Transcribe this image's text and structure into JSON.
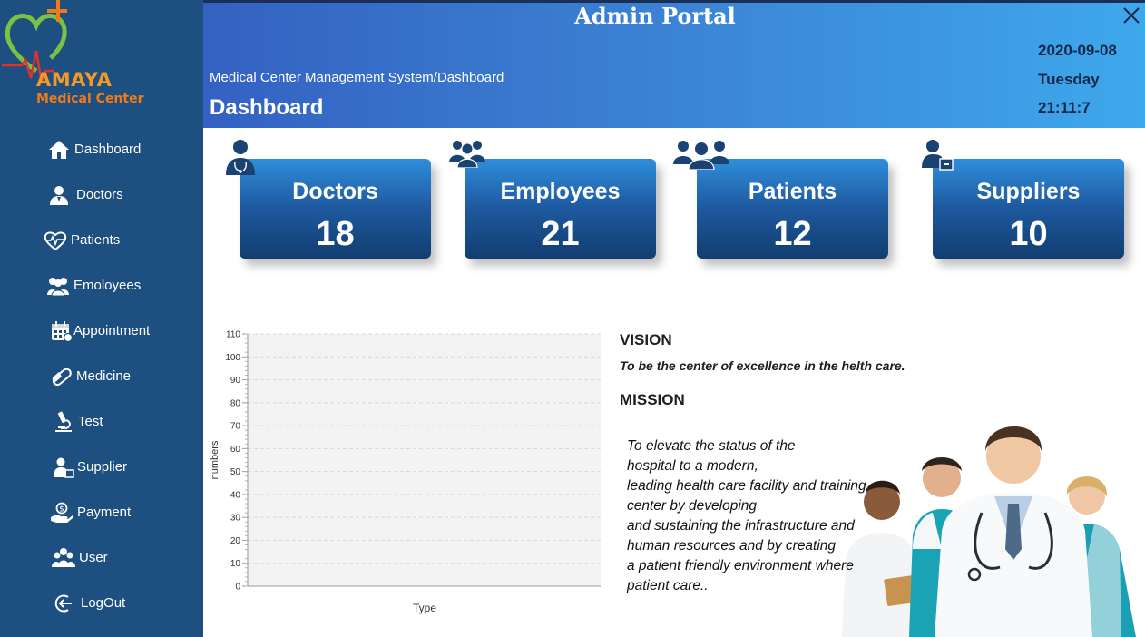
{
  "logo": {
    "name": "AMAYA",
    "subtitle": "Medical Center"
  },
  "sidebar": {
    "items": [
      {
        "label": "Dashboard",
        "icon": "home-icon"
      },
      {
        "label": "Doctors",
        "icon": "doctor-icon"
      },
      {
        "label": "Patients",
        "icon": "heart-pulse-icon"
      },
      {
        "label": "Emoloyees",
        "icon": "group-icon"
      },
      {
        "label": "Appointment",
        "icon": "calendar-icon"
      },
      {
        "label": "Medicine",
        "icon": "pill-icon"
      },
      {
        "label": "Test",
        "icon": "microscope-icon"
      },
      {
        "label": "Supplier",
        "icon": "supplier-icon"
      },
      {
        "label": "Payment",
        "icon": "payment-icon"
      },
      {
        "label": "User",
        "icon": "users-icon"
      },
      {
        "label": "LogOut",
        "icon": "logout-icon"
      }
    ]
  },
  "header": {
    "title": "Admin Portal",
    "breadcrumb": "Medical Center Management System/Dashboard",
    "page_title": "Dashboard",
    "date": "2020-09-08",
    "day": "Tuesday",
    "time": "21:11:7"
  },
  "stats": [
    {
      "label": "Doctors",
      "value": "18",
      "icon": "doctor-icon"
    },
    {
      "label": "Employees",
      "value": "21",
      "icon": "employees-icon"
    },
    {
      "label": "Patients",
      "value": "12",
      "icon": "patients-group-icon"
    },
    {
      "label": "Suppliers",
      "value": "10",
      "icon": "supplier-icon"
    }
  ],
  "chart_data": {
    "type": "bar",
    "categories": [],
    "values": [],
    "xlabel": "Type",
    "ylabel": "numbers",
    "ylim": [
      0,
      110
    ],
    "yticks": [
      "0",
      "10",
      "20",
      "30",
      "40",
      "50",
      "60",
      "70",
      "80",
      "90",
      "100",
      "110"
    ],
    "grid": true
  },
  "vision": {
    "heading": "VISION",
    "text": "To be the center of excellence in the helth care."
  },
  "mission": {
    "heading": "MISSION",
    "lines": [
      "To elevate the status of the",
      "hospital to a modern,",
      "leading health care facility and training",
      "center by developing",
      "and sustaining the infrastructure and",
      "human resources and by creating",
      "a patient friendly environment where",
      "patient care.."
    ]
  },
  "colors": {
    "sidebar": "#1d4f80",
    "header_start": "#3461c2",
    "header_end": "#3ea8ec",
    "card_top": "#2f8fdc",
    "card_bottom": "#123d70",
    "logo_orange": "#f19a2a",
    "logo_green": "#7cc242"
  }
}
